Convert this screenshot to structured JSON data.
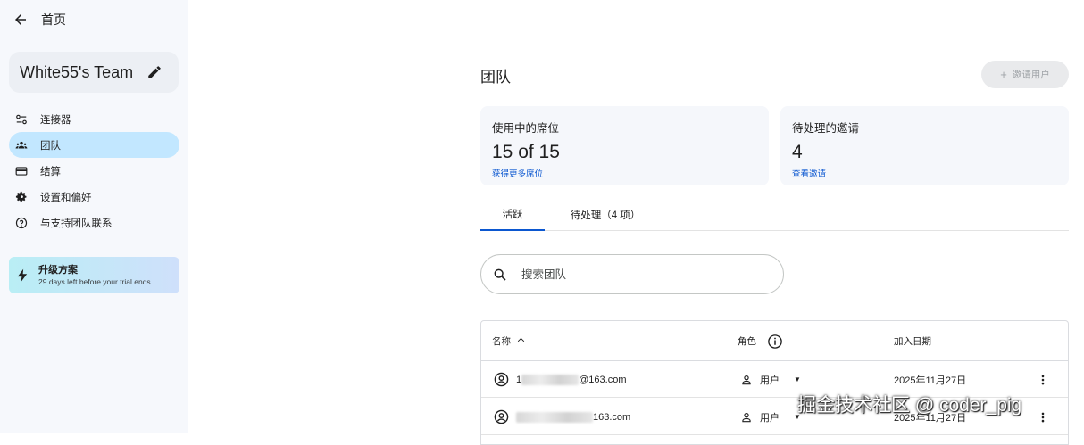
{
  "nav": {
    "back_label": "首页",
    "team_name": "White55's Team",
    "items": [
      {
        "label": "连接器",
        "icon": "connector-icon"
      },
      {
        "label": "团队",
        "icon": "team-icon",
        "active": true
      },
      {
        "label": "结算",
        "icon": "credit-card-icon"
      },
      {
        "label": "设置和偏好",
        "icon": "gear-icon"
      },
      {
        "label": "与支持团队联系",
        "icon": "help-icon"
      }
    ],
    "upgrade": {
      "title": "升级方案",
      "subtitle": "29 days left before your trial ends"
    }
  },
  "main": {
    "title": "团队",
    "invite_label": "邀请用户",
    "stats": [
      {
        "label": "使用中的席位",
        "value": "15 of 15",
        "link": "获得更多席位"
      },
      {
        "label": "待处理的邀请",
        "value": "4",
        "link": "查看邀请"
      }
    ],
    "tabs": [
      {
        "label": "活跃",
        "active": true
      },
      {
        "label": "待处理（4 项）",
        "active": false
      }
    ],
    "search_placeholder": "搜索团队",
    "table": {
      "columns": [
        "名称",
        "角色",
        "加入日期"
      ],
      "rows": [
        {
          "email_prefix": "1",
          "email_suffix": "@163.com",
          "role": "用户",
          "joined": "2025年11月27日"
        },
        {
          "email_prefix": "",
          "email_suffix": "163.com",
          "role": "用户",
          "joined": "2025年11月27日"
        }
      ]
    }
  },
  "watermark": "掘金技术社区 @ coder_pig",
  "colors": {
    "accent": "#0b57d0",
    "active_nav": "#c2e7ff",
    "sidebar_bg": "#f6f8fc"
  }
}
